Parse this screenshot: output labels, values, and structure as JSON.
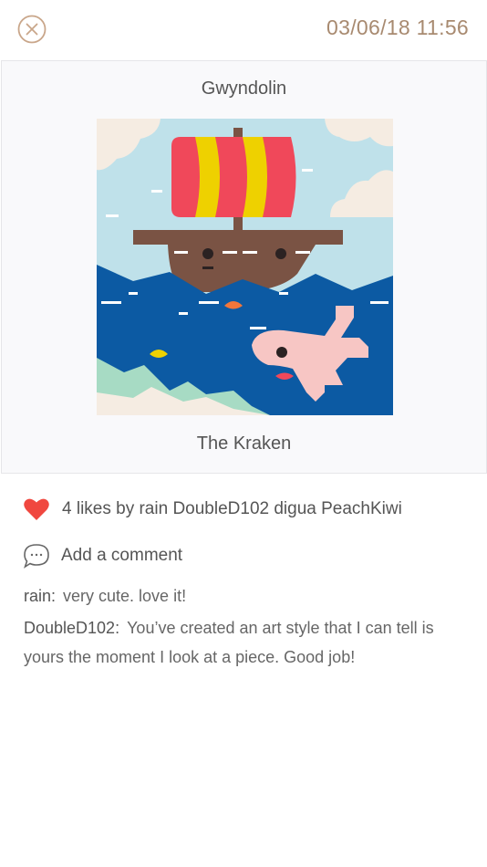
{
  "header": {
    "close_icon": "close-circle-icon",
    "timestamp": "03/06/18 11:56",
    "accent_color": "#c9a68a"
  },
  "post": {
    "author": "Gwyndolin",
    "title": "The Kraken",
    "image_description_icon": "ship-kraken-artwork"
  },
  "likes": {
    "icon": "heart-icon",
    "color": "#f0473f",
    "text": "4 likes by rain DoubleD102 digua PeachKiwi"
  },
  "comment_box": {
    "icon": "speech-bubble-icon",
    "placeholder": "Add a comment"
  },
  "comments": [
    {
      "user": "rain:",
      "text": "very cute. love it!"
    },
    {
      "user": "DoubleD102:",
      "text": "You’ve created an art style that I can tell is yours the moment I look at a piece. Good job!"
    }
  ]
}
